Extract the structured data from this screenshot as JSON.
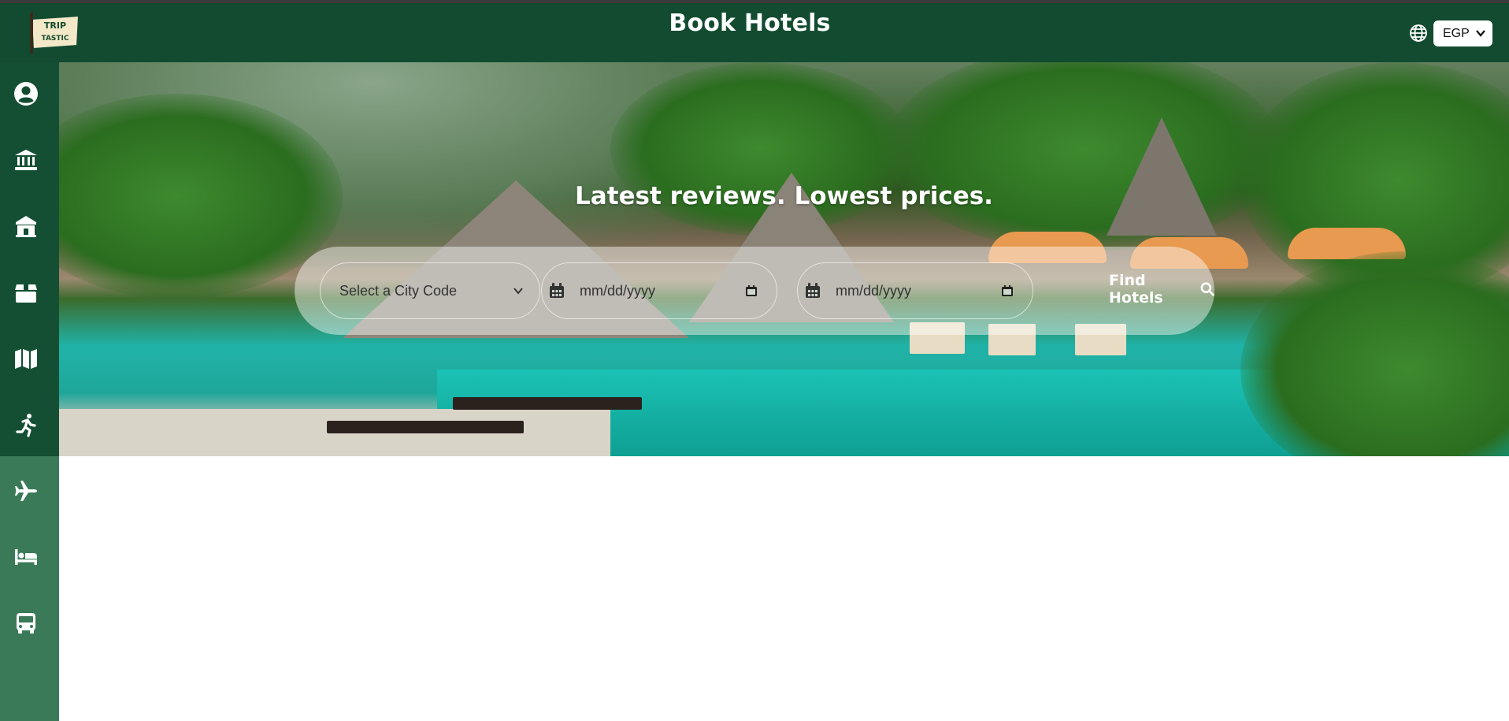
{
  "navbar": {
    "logo_text": "TRIP TASTIC",
    "title": "Book Hotels",
    "currency": {
      "selected": "EGP",
      "options": [
        "EGP"
      ]
    },
    "language_icon": "globe-icon"
  },
  "sidebar": {
    "items": [
      {
        "icon": "user-circle-icon",
        "name": "profile"
      },
      {
        "icon": "museum-icon",
        "name": "museums"
      },
      {
        "icon": "landmark-icon",
        "name": "historical-places"
      },
      {
        "icon": "box-icon",
        "name": "products"
      },
      {
        "icon": "map-icon",
        "name": "itineraries"
      },
      {
        "icon": "running-icon",
        "name": "activities"
      },
      {
        "icon": "plane-icon",
        "name": "flights"
      },
      {
        "icon": "bed-icon",
        "name": "hotels"
      },
      {
        "icon": "bus-icon",
        "name": "transportation"
      }
    ]
  },
  "hero": {
    "heading": "Latest reviews. Lowest prices.",
    "search": {
      "city_placeholder": "Select a City Code",
      "check_in_placeholder": "mm/dd/yyyy",
      "check_out_placeholder": "mm/dd/yyyy",
      "find_label": "Find Hotels"
    }
  },
  "colors": {
    "navbar": "#124b30",
    "sidebar": "#3a7a58",
    "text_on_dark": "#ffffff"
  }
}
